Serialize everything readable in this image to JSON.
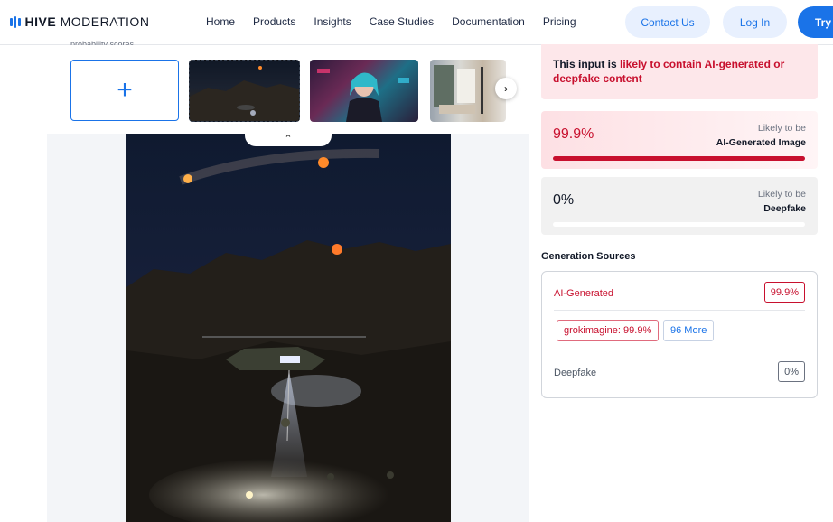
{
  "header": {
    "brand_bold": "HIVE",
    "brand_rest": " MODERATION",
    "nav": [
      "Home",
      "Products",
      "Insights",
      "Case Studies",
      "Documentation",
      "Pricing"
    ],
    "contact_label": "Contact Us",
    "login_label": "Log In",
    "try_label": "Try"
  },
  "upload": {
    "clipped_text": "probability scores.",
    "add_symbol": "+",
    "next_icon": "chevron-right-icon",
    "collapse_icon": "chevron-up-icon"
  },
  "result": {
    "alert_prefix": "This input is ",
    "alert_highlight": "likely to contain AI-generated or deepfake content",
    "ai_score": {
      "percent": "99.9%",
      "likely_label": "Likely to be",
      "category": "AI-Generated Image",
      "fill_fraction": 0.999
    },
    "deepfake_score": {
      "percent": "0%",
      "likely_label": "Likely to be",
      "category": "Deepfake",
      "fill_fraction": 0
    },
    "sources_title": "Generation Sources",
    "ai_row_label": "AI-Generated",
    "ai_row_value": "99.9%",
    "chip_source": "grokimagine: 99.9%",
    "chip_more": "96 More",
    "df_row_label": "Deepfake",
    "df_row_value": "0%"
  },
  "colors": {
    "accent": "#1a73e8",
    "danger": "#c8102e"
  }
}
